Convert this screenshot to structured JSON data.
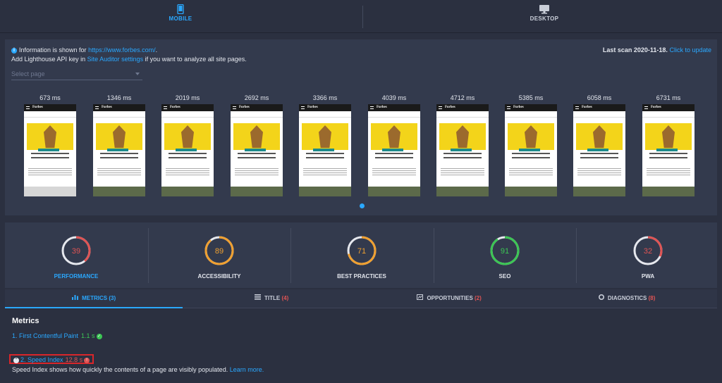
{
  "tabs_top": {
    "mobile": "MOBILE",
    "desktop": "DESKTOP",
    "mobile_icon": "mobile-phone-icon",
    "desktop_icon": "desktop-monitor-icon"
  },
  "info": {
    "prefix": "Information is shown for",
    "url": "https://www.forbes.com/",
    "suffix": ".",
    "line2_prefix": "Add Lighthouse API key in",
    "line2_link": "Site Auditor settings",
    "line2_suffix": "if you want to analyze all site pages.",
    "last_scan_label": "Last scan 2020-11-18.",
    "update_link": "Click to update"
  },
  "select": {
    "placeholder": "Select page"
  },
  "filmstrip": {
    "times": [
      "673 ms",
      "1346 ms",
      "2019 ms",
      "2692 ms",
      "3366 ms",
      "4039 ms",
      "4712 ms",
      "5385 ms",
      "6058 ms",
      "6731 ms"
    ],
    "site_logo": "Forbes"
  },
  "scores": [
    {
      "name": "PERFORMANCE",
      "value": 39,
      "color": "#e05454"
    },
    {
      "name": "ACCESSIBILITY",
      "value": 89,
      "color": "#f0a030"
    },
    {
      "name": "BEST PRACTICES",
      "value": 71,
      "color": "#f0a030"
    },
    {
      "name": "SEO",
      "value": 91,
      "color": "#3cc654"
    },
    {
      "name": "PWA",
      "value": 32,
      "color": "#e05454"
    }
  ],
  "tabs": [
    {
      "label": "METRICS",
      "count": "(3)",
      "icon": "bar-chart-icon"
    },
    {
      "label": "TITLE",
      "count": "(4)",
      "icon": "title-icon"
    },
    {
      "label": "OPPORTUNITIES",
      "count": "(2)",
      "icon": "opportunities-icon"
    },
    {
      "label": "DIAGNOSTICS",
      "count": "(8)",
      "icon": "diagnostics-icon"
    }
  ],
  "metrics": {
    "title": "Metrics",
    "m1_label": "1. First Contentful Paint",
    "m1_value": "1.1 s",
    "m2_label": "2. Speed Index",
    "m2_value": "12.8 s",
    "m2_desc": "Speed Index shows how quickly the contents of a page are visibly populated.",
    "learn_more": "Learn more."
  }
}
